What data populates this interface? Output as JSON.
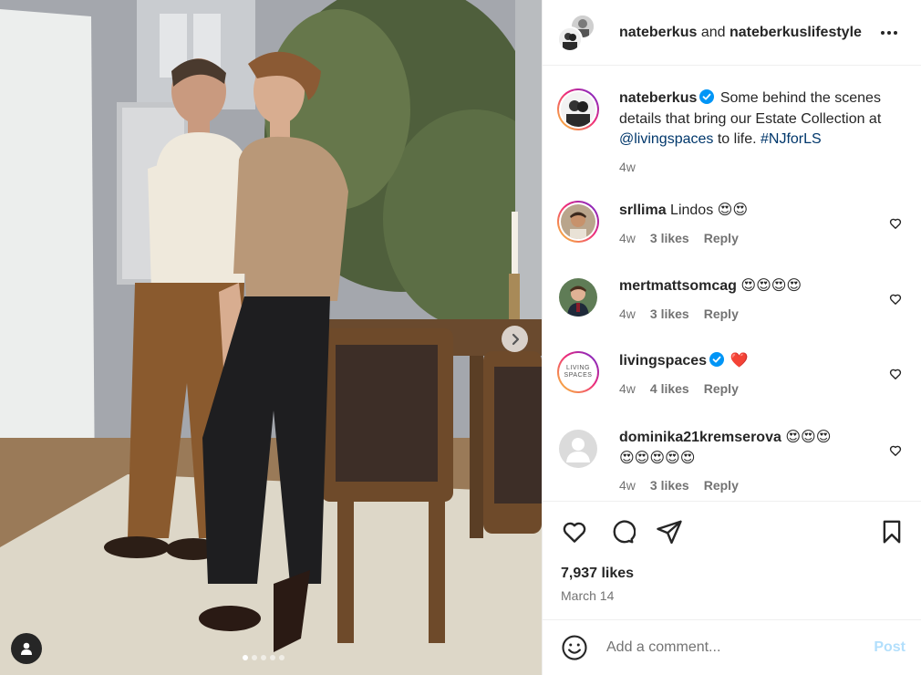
{
  "post": {
    "owner": "nateberkus",
    "and": " and ",
    "collaborator": "nateberkuslifestyle",
    "caption_user": "nateberkus",
    "caption_text_1": "Some behind the scenes details that bring our Estate Collection at ",
    "caption_mention": "@livingspaces",
    "caption_text_2": " to life. ",
    "caption_hashtag": "#NJforLS",
    "caption_time": "4w"
  },
  "comments": [
    {
      "user": "srllima",
      "text": "Lindos 😍😍",
      "time": "4w",
      "likes": "3 likes",
      "reply": "Reply"
    },
    {
      "user": "mertmattsomcag",
      "text": "😍😍😍😍",
      "time": "4w",
      "likes": "3 likes",
      "reply": "Reply"
    },
    {
      "user": "livingspaces",
      "text": "❤️",
      "time": "4w",
      "likes": "4 likes",
      "reply": "Reply",
      "avatar_text_1": "LIVING",
      "avatar_text_2": "SPACES"
    },
    {
      "user": "dominika21kremserova",
      "text": "😍😍😍",
      "text2": "😍😍😍😍😍",
      "time": "4w",
      "likes": "3 likes",
      "reply": "Reply"
    }
  ],
  "footer": {
    "likes": "7,937 likes",
    "date": "March 14",
    "comment_placeholder": "Add a comment...",
    "post_label": "Post"
  },
  "icons": {
    "like": "heart-icon",
    "comment": "comment-bubble-icon",
    "share": "paper-plane-icon",
    "save": "bookmark-icon",
    "more": "ellipsis-icon",
    "emoji": "smiley-icon",
    "next": "chevron-right-icon",
    "tag": "user-tag-icon"
  },
  "carousel": {
    "slides": 5,
    "current": 1
  },
  "colors": {
    "verified": "#0095f6",
    "link": "#00376b",
    "muted": "#737373",
    "post_disabled": "#b2dffc"
  }
}
